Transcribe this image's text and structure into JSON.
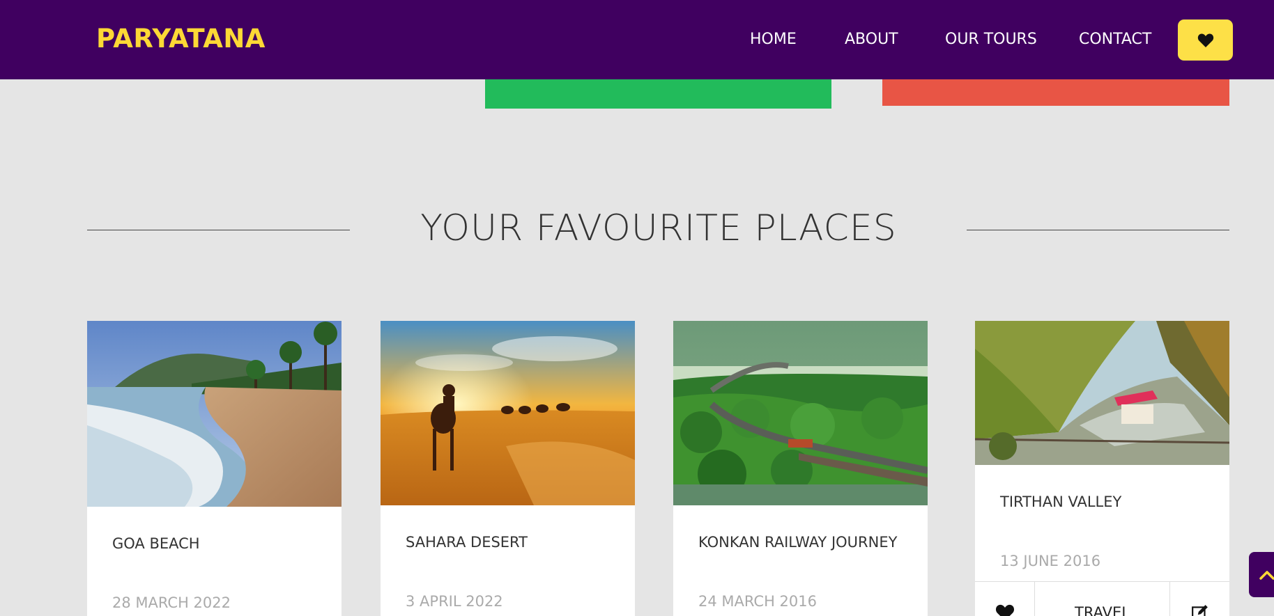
{
  "brand": "PARYATANA",
  "nav": {
    "home": "HOME",
    "about": "ABOUT",
    "tours": "OUR TOURS",
    "contact": "CONTACT"
  },
  "section": {
    "title": "YOUR FAVOURITE PLACES"
  },
  "cards": [
    {
      "title": "GOA BEACH",
      "date": "28 MARCH 2022"
    },
    {
      "title": "SAHARA DESERT",
      "date": "3 APRIL 2022"
    },
    {
      "title": "KONKAN RAILWAY JOURNEY",
      "date": "24 MARCH 2016"
    },
    {
      "title": "TIRTHAN VALLEY",
      "date": "13 JUNE 2016",
      "footer_label": "TRAVEL"
    }
  ],
  "colors": {
    "header": "#400060",
    "brand": "#fdd835",
    "heart_button": "#fde047",
    "green_block": "#22bb5b",
    "red_block": "#e85545"
  },
  "icons": [
    "heart-icon",
    "edit-icon",
    "chevron-up-icon"
  ]
}
